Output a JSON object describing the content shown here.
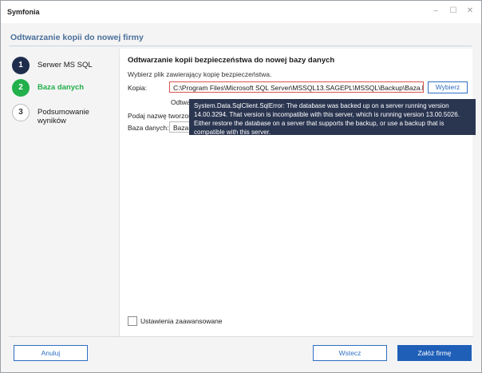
{
  "window": {
    "title": "Symfonia",
    "minimize": "–",
    "maximize": "☐",
    "close": "✕"
  },
  "header": {
    "title": "Odtwarzanie kopii do nowej firmy"
  },
  "steps": [
    {
      "number": "1",
      "label": "Serwer MS SQL"
    },
    {
      "number": "2",
      "label": "Baza danych"
    },
    {
      "number": "3",
      "label": "Podsumowanie wyników"
    }
  ],
  "content": {
    "title": "Odtwarzanie kopii bezpieczeństwa do nowej bazy danych",
    "subtitle": "Wybierz plik zawierający kopię bezpieczeństwa.",
    "kopia_label": "Kopia:",
    "kopia_value": "C:\\Program Files\\Microsoft SQL Server\\MSSQL13.SAGEPL\\MSSQL\\Backup\\Baza.bak",
    "browse_label": "Wybierz",
    "partial_label": "Odtwar",
    "name_prompt": "Podaj nazwę tworzonej b",
    "db_label": "Baza danych:",
    "db_value": "Baza"
  },
  "tooltip": {
    "text": "System.Data.SqlClient.SqlError: The database was backed up on a server running version 14.00.3294. That version is incompatible with this server, which is running version 13.00.5026. Either restore the database on a server that supports the backup, or use a backup that is compatible with this server."
  },
  "advanced": {
    "label": "Ustawienia zaawansowane"
  },
  "footer": {
    "cancel": "Anuluj",
    "back": "Wstecz",
    "create": "Załóż firmę"
  },
  "colors": {
    "accent": "#2f6fc3",
    "step_done": "#1f2d4d",
    "step_active": "#22b04b",
    "error_border": "#d9534f",
    "tooltip_bg": "#2a3550"
  }
}
